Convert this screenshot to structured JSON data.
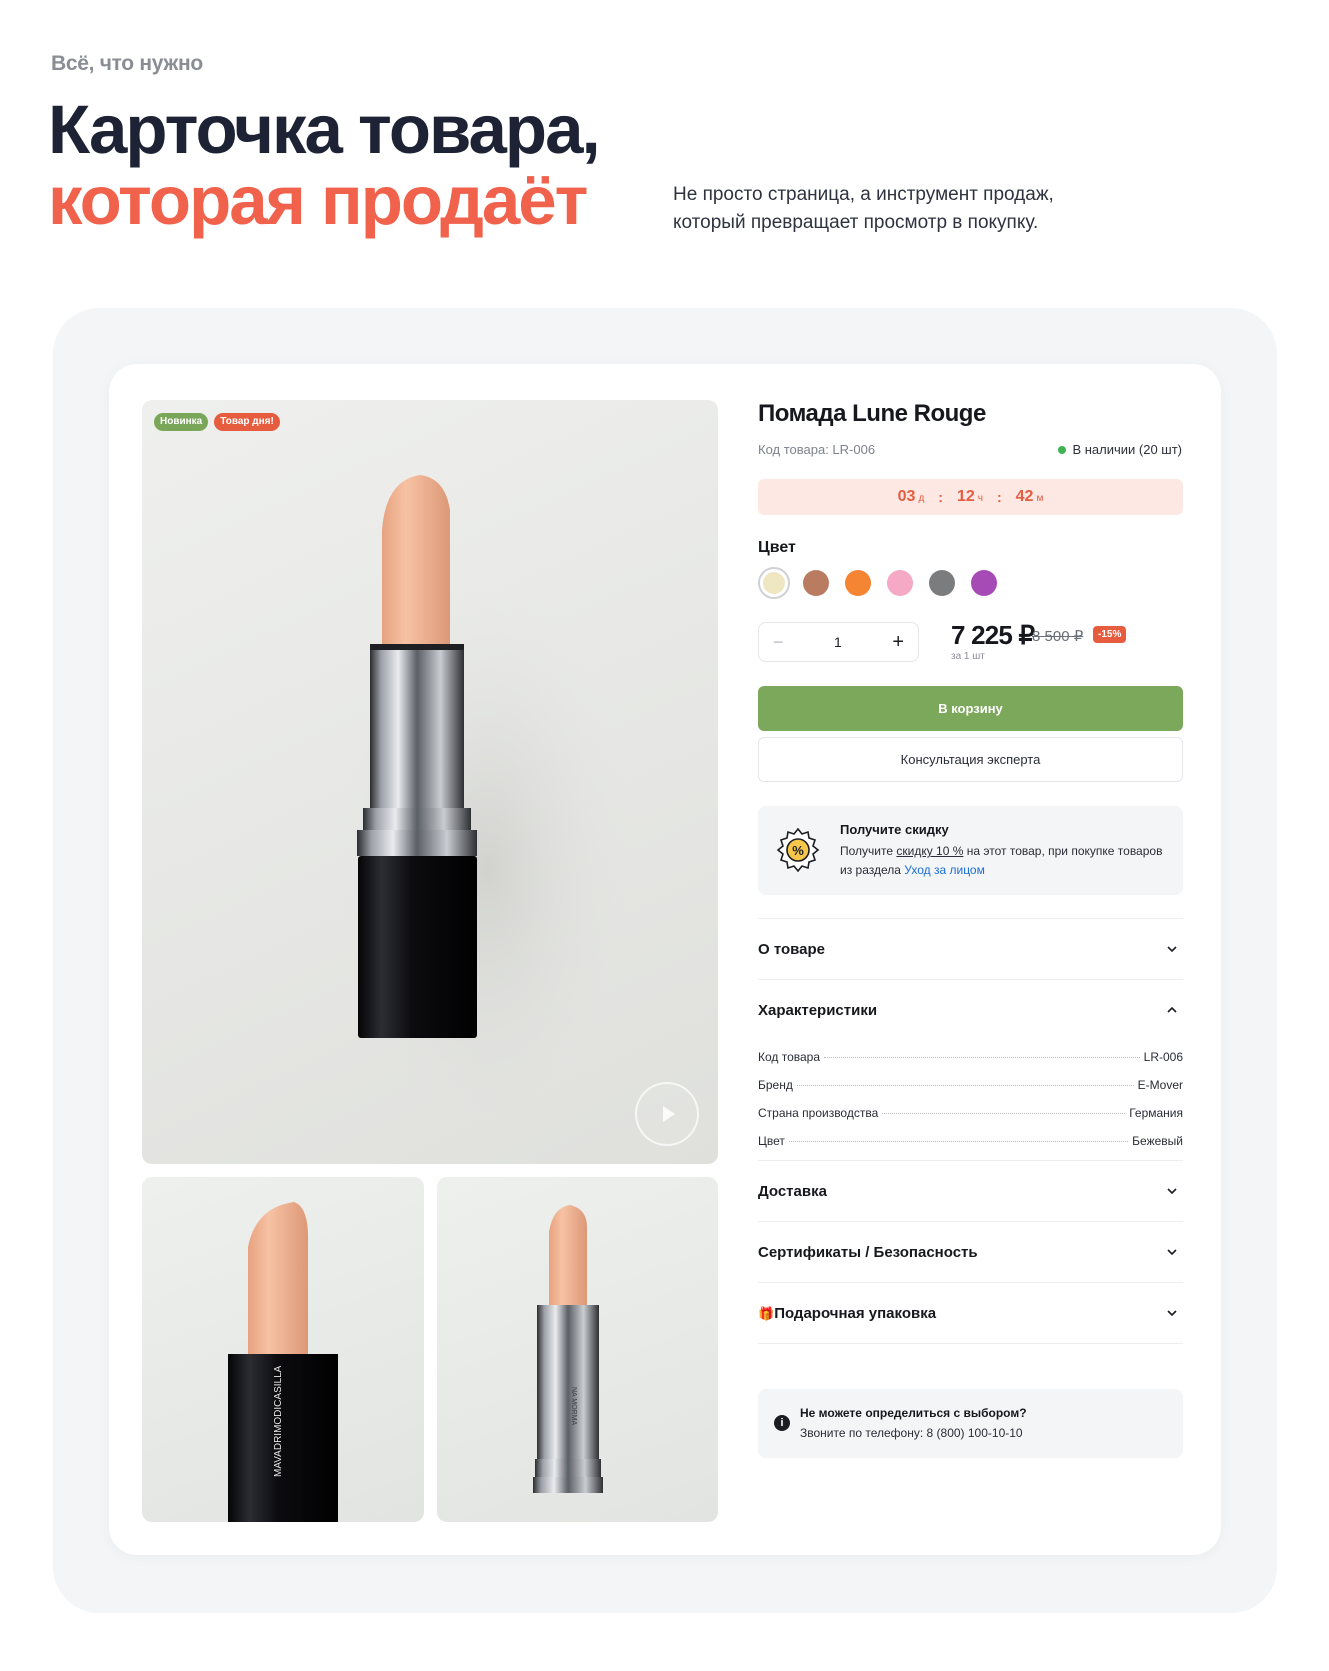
{
  "header": {
    "eyebrow": "Всё, что нужно",
    "title_line1": "Карточка товара,",
    "title_line2": "которая продаёт",
    "subtitle": "Не просто страница, а инструмент продаж, который превращает просмотр в покупку."
  },
  "product": {
    "badges": [
      "Новинка",
      "Товар дня!"
    ],
    "name": "Помада Lune Rouge",
    "sku_label": "Код товара: LR-006",
    "stock": "В наличии (20 шт)",
    "timer": {
      "days": "03",
      "days_unit": "д",
      "hours": "12",
      "hours_unit": "ч",
      "minutes": "42",
      "minutes_unit": "м",
      "sep": ":"
    },
    "color_label": "Цвет",
    "swatches": [
      "#efe6c2",
      "#b97c61",
      "#f58433",
      "#f6a9c4",
      "#7b7c7e",
      "#a64bb5"
    ],
    "quantity": "1",
    "minus": "−",
    "plus": "+",
    "price": "7 225 ₽",
    "old_price": "8 500 ₽",
    "discount": "-15%",
    "per_unit": "за 1 шт",
    "cart_button": "В корзину",
    "expert_button": "Консультация эксперта"
  },
  "promo": {
    "title": "Получите скидку",
    "text_before": "Получите ",
    "link_discount": "скидку 10 %",
    "text_middle": " на этот товар, при покупке товаров из раздела ",
    "link_section": "Уход за лицом"
  },
  "accordion": {
    "about": "О товаре",
    "specs": "Характеристики",
    "delivery": "Доставка",
    "certs": "Сертификаты / Безопасность",
    "gift": "Подарочная упаковка",
    "gift_icon": "🎁"
  },
  "specs": [
    {
      "label": "Код товара",
      "value": "LR-006"
    },
    {
      "label": "Бренд",
      "value": "E-Mover"
    },
    {
      "label": "Страна производства",
      "value": "Германия"
    },
    {
      "label": "Цвет",
      "value": "Бежевый"
    }
  ],
  "help": {
    "title": "Не можете определиться с выбором?",
    "text": "Звоните по телефону: 8 (800) 100-10-10",
    "icon": "i"
  },
  "thumb_text": {
    "thumb1": "MAVADRIMODICASILLA",
    "thumb2": "NA MORMA"
  }
}
